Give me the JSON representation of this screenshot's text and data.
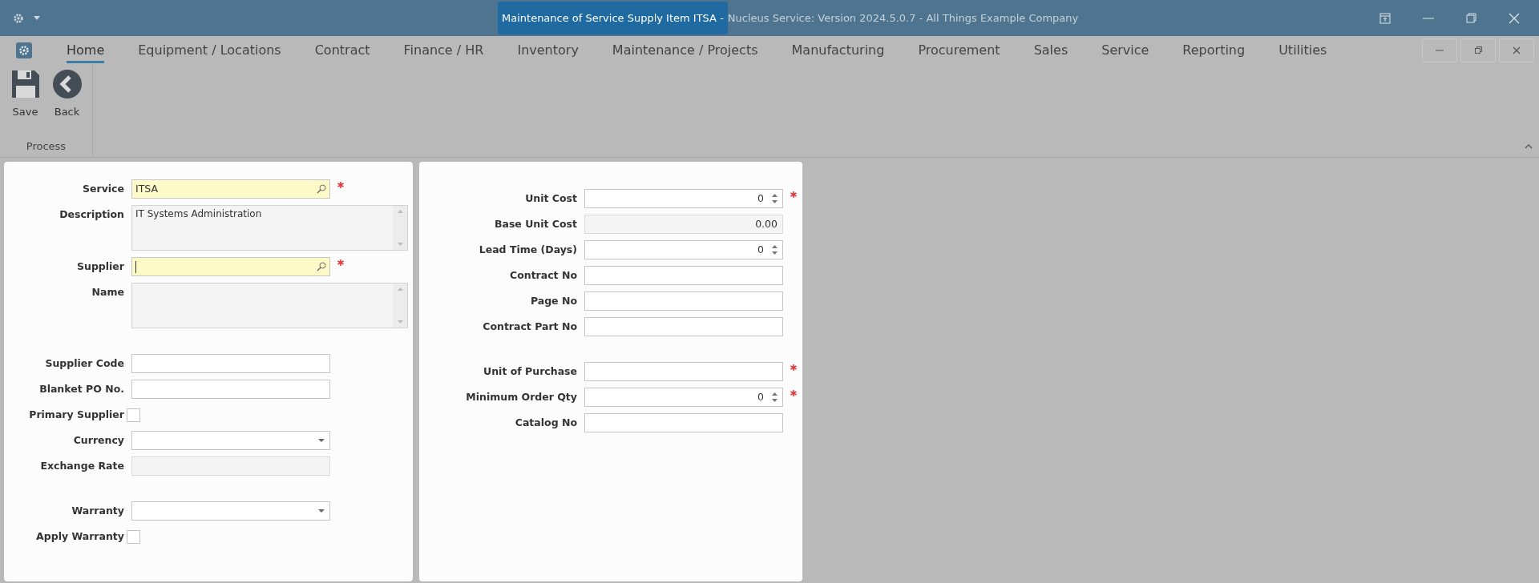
{
  "title_bar": {
    "title": "Maintenance of Service Supply Item ITSA - ",
    "subtitle": "Nucleus Service: Version 2024.5.0.7 - All Things Example Company"
  },
  "menu_tabs": [
    {
      "label": "Home",
      "selected": true
    },
    {
      "label": "Equipment / Locations",
      "selected": false
    },
    {
      "label": "Contract",
      "selected": false
    },
    {
      "label": "Finance / HR",
      "selected": false
    },
    {
      "label": "Inventory",
      "selected": false
    },
    {
      "label": "Maintenance / Projects",
      "selected": false
    },
    {
      "label": "Manufacturing",
      "selected": false
    },
    {
      "label": "Procurement",
      "selected": false
    },
    {
      "label": "Sales",
      "selected": false
    },
    {
      "label": "Service",
      "selected": false
    },
    {
      "label": "Reporting",
      "selected": false
    },
    {
      "label": "Utilities",
      "selected": false
    }
  ],
  "ribbon": {
    "groups": [
      {
        "label": "Process",
        "buttons": [
          {
            "kind": "save",
            "label": "Save"
          },
          {
            "kind": "back",
            "label": "Back"
          }
        ]
      }
    ]
  },
  "left_form": {
    "groups": [
      [
        {
          "label": "Service",
          "kind": "lookup",
          "value": "ITSA",
          "required": true,
          "focused": false
        },
        {
          "label": "Description",
          "kind": "memo",
          "value": "IT Systems Administration"
        },
        {
          "label": "Supplier",
          "kind": "lookup",
          "required": true,
          "focused": true
        },
        {
          "label": "Name",
          "kind": "memo"
        }
      ],
      [
        {
          "label": "Supplier Code",
          "kind": "text"
        },
        {
          "label": "Blanket PO No.",
          "kind": "text"
        },
        {
          "label": "Primary Supplier",
          "kind": "checkbox",
          "checked": false
        },
        {
          "label": "Currency",
          "kind": "dropdown"
        },
        {
          "label": "Exchange Rate",
          "kind": "readonly"
        }
      ],
      [
        {
          "label": "Warranty",
          "kind": "dropdown"
        },
        {
          "label": "Apply Warranty",
          "kind": "checkbox",
          "checked": false
        }
      ]
    ]
  },
  "right_form": {
    "groups": [
      [
        {
          "label": "Unit Cost",
          "kind": "spinner",
          "value": "0",
          "required": true
        },
        {
          "label": "Base Unit Cost",
          "kind": "readonly",
          "value": "0.00"
        },
        {
          "label": "Lead Time (Days)",
          "kind": "spinner",
          "value": "0",
          "required": false
        },
        {
          "label": "Contract No",
          "kind": "text"
        },
        {
          "label": "Page No",
          "kind": "text"
        },
        {
          "label": "Contract Part No",
          "kind": "text"
        }
      ],
      [
        {
          "label": "Unit of Purchase",
          "kind": "text",
          "required": true
        },
        {
          "label": "Minimum Order Qty",
          "kind": "spinner",
          "value": "0",
          "required": true
        },
        {
          "label": "Catalog No",
          "kind": "text"
        }
      ]
    ]
  }
}
